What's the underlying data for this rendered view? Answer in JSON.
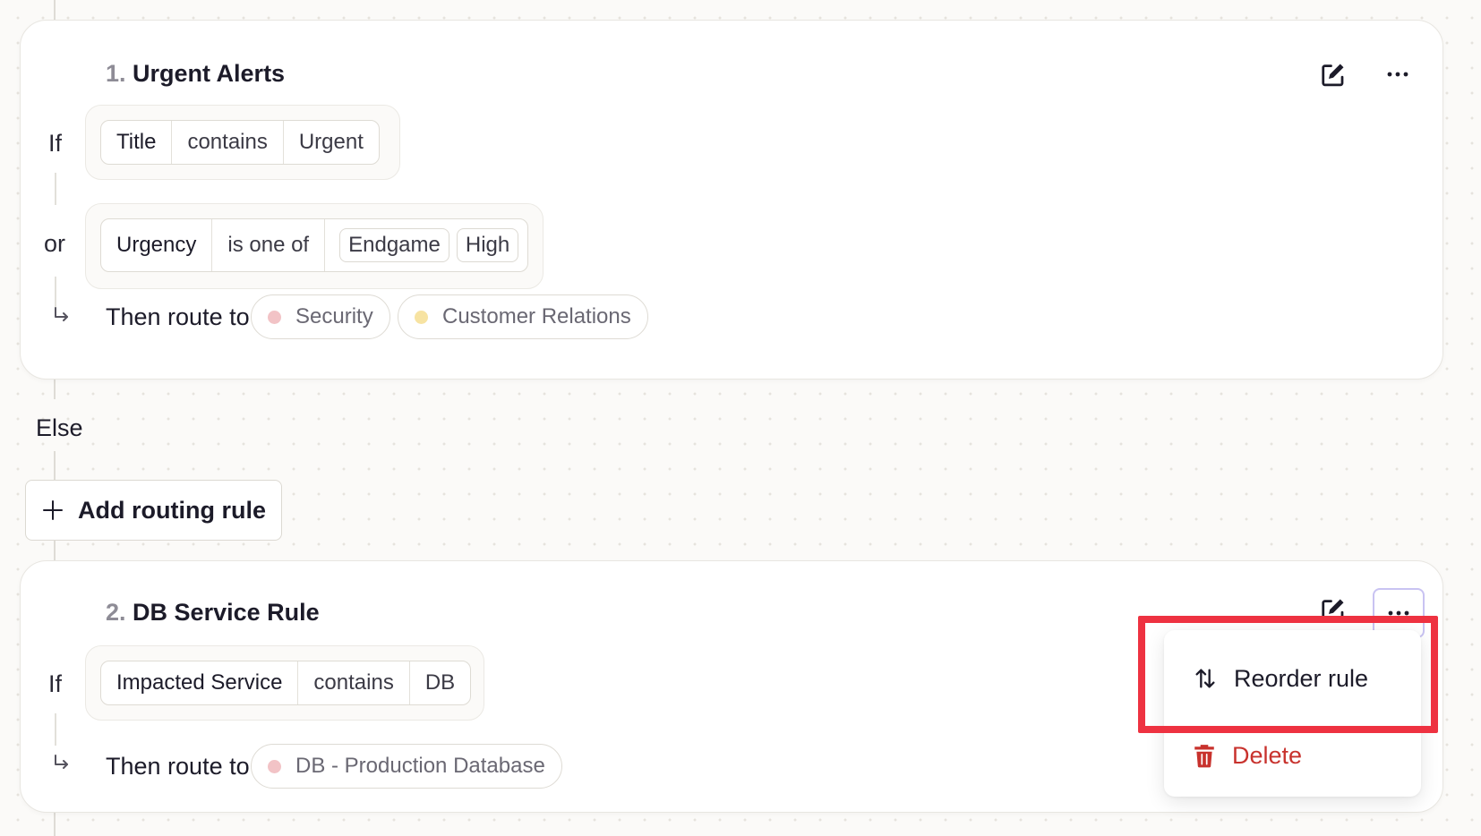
{
  "rules": [
    {
      "number": "1.",
      "title": "Urgent Alerts",
      "if_label": "If",
      "or_label": "or",
      "conditions": [
        {
          "field": "Title",
          "operator": "contains",
          "value": "Urgent"
        },
        {
          "field": "Urgency",
          "operator": "is one of",
          "values": [
            "Endgame",
            "High"
          ]
        }
      ],
      "then_label": "Then route to",
      "teams": [
        {
          "name": "Security",
          "color": "#f2c3c6"
        },
        {
          "name": "Customer Relations",
          "color": "#f7e3a2"
        }
      ]
    },
    {
      "number": "2.",
      "title": "DB Service Rule",
      "if_label": "If",
      "conditions": [
        {
          "field": "Impacted Service",
          "operator": "contains",
          "value": "DB"
        }
      ],
      "then_label": "Then route to",
      "teams": [
        {
          "name": "DB - Production Database",
          "color": "#f2c3c6"
        }
      ]
    }
  ],
  "else_label": "Else",
  "add_rule_label": "Add routing rule",
  "menu": {
    "reorder_label": "Reorder rule",
    "delete_label": "Delete"
  },
  "colors": {
    "accent_red": "#c8322d",
    "highlight": "#ee3241",
    "focus_ring": "#c9c3f2"
  }
}
